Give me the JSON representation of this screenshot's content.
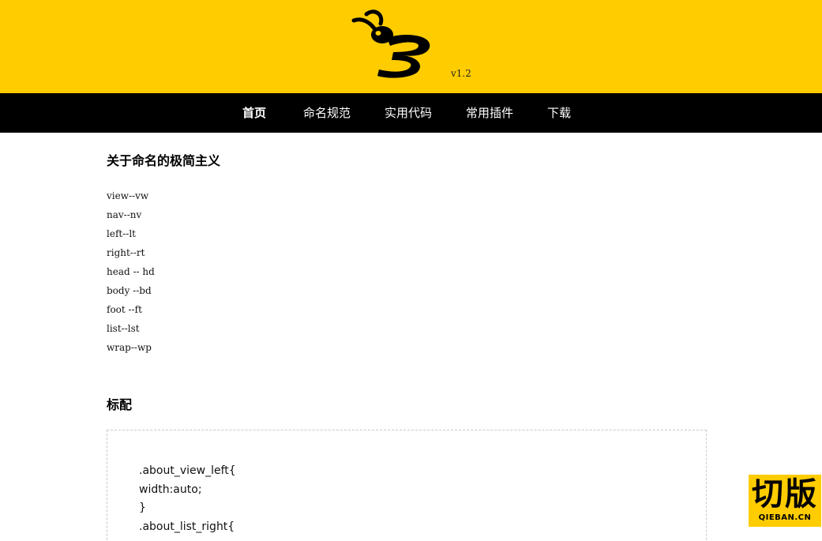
{
  "header": {
    "version": "v1.2",
    "logo_icon": "bee-logo-icon",
    "background_color": "#ffcc00"
  },
  "nav": {
    "items": [
      {
        "label": "首页",
        "active": true
      },
      {
        "label": "命名规范",
        "active": false
      },
      {
        "label": "实用代码",
        "active": false
      },
      {
        "label": "常用插件",
        "active": false
      },
      {
        "label": "下载",
        "active": false
      }
    ],
    "background_color": "#000000"
  },
  "main": {
    "section1": {
      "title": "关于命名的极简主义",
      "items": [
        "view--vw",
        "nav--nv",
        "left--lt",
        "right--rt",
        "head -- hd",
        "body --bd",
        "foot --ft",
        "list--lst",
        "wrap--wp"
      ]
    },
    "section2": {
      "title": "标配",
      "code_lines": [
        ".about_view_left{",
        "width:auto;",
        "}",
        ".about_list_right{"
      ]
    }
  },
  "badge": {
    "text": "切版",
    "sub_text": "QIEBAN.CN",
    "background_color": "#ffcc00"
  }
}
